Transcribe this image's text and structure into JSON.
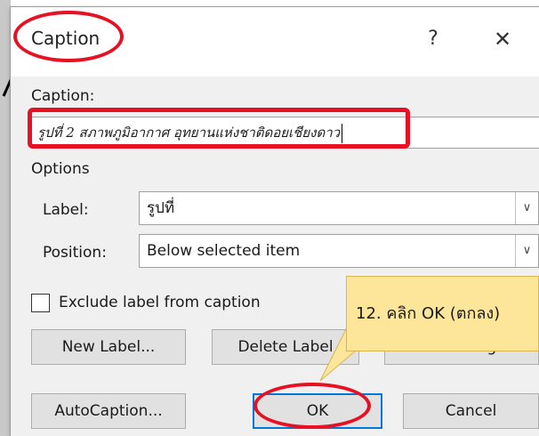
{
  "dialog": {
    "title": "Caption",
    "help_icon": "question-mark-icon",
    "help_glyph": "?",
    "close_icon": "close-icon",
    "close_glyph": "✕"
  },
  "caption": {
    "label": "Caption:",
    "value": "รูปที่ 2 สภาพภูมิอากาศ อุทยานแห่งชาติดอยเชียงดาว"
  },
  "options": {
    "heading": "Options",
    "label_field": {
      "label": "Label:",
      "value": "รูปที่"
    },
    "position_field": {
      "label": "Position:",
      "value": "Below selected item"
    },
    "dropdown_icon": "chevron-down-icon",
    "dropdown_glyph": "∨"
  },
  "exclude_label": "Exclude label from caption",
  "buttons": {
    "new_label": "New Label...",
    "delete_label": "Delete Label",
    "numbering": "Numbering...",
    "autocaption": "AutoCaption...",
    "ok": "OK",
    "cancel": "Cancel"
  },
  "callout": {
    "text": "12. คลิก OK (ตกลง)"
  },
  "colors": {
    "highlight_red": "#e81123",
    "callout_fill": "#fde699",
    "ok_focus_border": "#0078d7"
  }
}
